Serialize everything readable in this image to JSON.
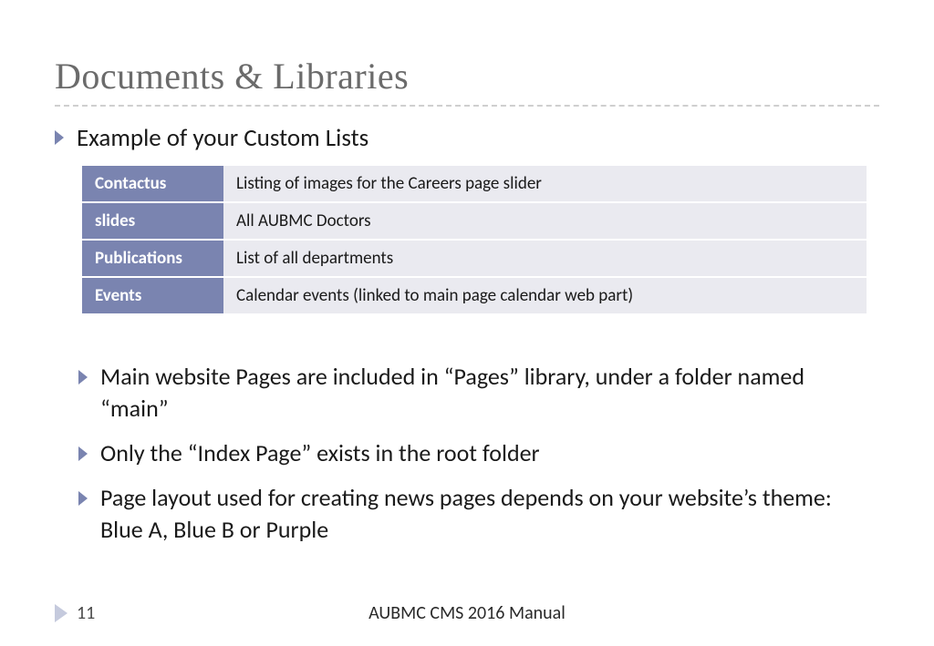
{
  "title": "Documents & Libraries",
  "section_heading": "Example of your Custom Lists",
  "table": [
    {
      "label": "Contactus",
      "desc": "Listing of images for the Careers page slider"
    },
    {
      "label": "slides",
      "desc": "All AUBMC Doctors"
    },
    {
      "label": "Publications",
      "desc": "List of all departments"
    },
    {
      "label": "Events",
      "desc": "Calendar events (linked to main page calendar web part)"
    }
  ],
  "bullets": [
    "Main website Pages are included in “Pages” library, under a folder named “main”",
    "Only the “Index Page” exists in the root folder",
    "Page layout used for creating news pages depends on your website’s theme:  Blue A, Blue B or Purple"
  ],
  "footer": {
    "page": "11",
    "doc_title": "AUBMC CMS 2016 Manual"
  }
}
